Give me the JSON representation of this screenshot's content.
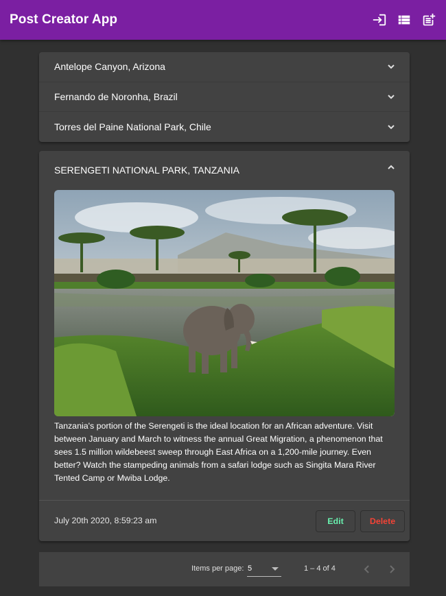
{
  "app": {
    "title": "Post Creator App"
  },
  "toolbar": {
    "icons": [
      "login-icon",
      "view-list-icon",
      "post-add-icon"
    ]
  },
  "accordion": {
    "items": [
      {
        "title": "Antelope Canyon, Arizona"
      },
      {
        "title": "Fernando de Noronha, Brazil"
      },
      {
        "title": "Torres del Paine National Park, Chile"
      }
    ]
  },
  "post": {
    "title": "SERENGETI NATIONAL PARK, TANZANIA",
    "description": "Tanzania's portion of the Serengeti is the ideal location for an African adventure. Visit between January and March to witness the annual Great Migration, a phenomenon that sees 1.5 million wildebeest sweep through East Africa on a 1,200-mile journey. Even better? Watch the stampeding animals from a safari lodge such as Singita Mara River Tented Camp or Mwiba Lodge.",
    "timestamp": "July 20th 2020, 8:59:23 am",
    "edit_label": "Edit",
    "delete_label": "Delete"
  },
  "paginator": {
    "items_per_page_label": "Items per page:",
    "items_per_page_value": "5",
    "range_label": "1 – 4 of 4"
  },
  "colors": {
    "primary": "#7b1fa2",
    "background": "#303030",
    "surface": "#424242",
    "edit": "#69f0ae",
    "delete": "#f44336"
  }
}
